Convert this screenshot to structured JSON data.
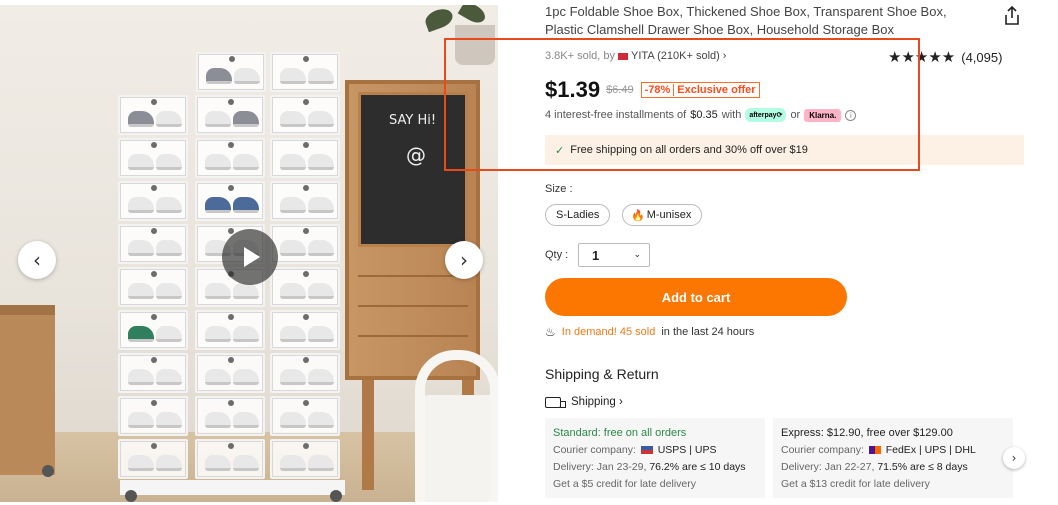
{
  "product": {
    "title": "1pc Foldable Shoe Box, Thickened Shoe Box, Transparent Shoe Box, Plastic Clamshell Drawer Shoe Box, Household Storage Box",
    "sold_text": "3.8K+ sold, by",
    "store_name": "YITA (210K+ sold)",
    "store_chevron": "›",
    "rating_stars": "★★★★★",
    "rating_count": "(4,095)",
    "price": "$1.39",
    "original_price": "$6.49",
    "discount": "-78%",
    "offer_label": "Exclusive offer",
    "installment_prefix": "4 interest-free installments of",
    "installment_amount": "$0.35",
    "installment_with": "with",
    "afterpay_label": "afterpay⟳",
    "installment_or": "or",
    "klarna_label": "Klarna.",
    "info_icon": "i",
    "shipping_banner_check": "✓",
    "shipping_banner": "Free shipping on all orders and 30% off over $19"
  },
  "gallery": {
    "board_text_1": "SAY Hi!",
    "board_text_2": "@",
    "prev_icon": "‹",
    "next_icon": "›"
  },
  "options": {
    "size_label": "Size :",
    "sizes": [
      "S-Ladies",
      "M-unisex"
    ],
    "qty_label": "Qty :",
    "qty_value": "1",
    "qty_caret": "⌄",
    "add_to_cart": "Add to cart",
    "demand_hot": "In demand! 45 sold",
    "demand_rest": "in the last 24 hours",
    "demand_icon": "♨"
  },
  "shipping": {
    "heading": "Shipping & Return",
    "link_label": "Shipping ›",
    "next_icon": "›",
    "cards": [
      {
        "title": "Standard: free on all orders",
        "courier_label": "Courier company:",
        "couriers": "USPS | UPS",
        "delivery": "Delivery: Jan 23-29,",
        "delivery_stat": "76.2% are ≤ 10 days",
        "credit": "Get a $5 credit for late delivery"
      },
      {
        "title": "Express: $12.90, free over $129.00",
        "courier_label": "Courier company:",
        "couriers": "FedEx | UPS | DHL",
        "delivery": "Delivery: Jan 22-27,",
        "delivery_stat": "71.5% are ≤ 8 days",
        "credit": "Get a $13 credit for late delivery"
      }
    ]
  },
  "colors": {
    "accent": "#fb7701",
    "highlight": "#e8491d",
    "discount": "#ff4a1a",
    "success": "#2a8a46"
  }
}
